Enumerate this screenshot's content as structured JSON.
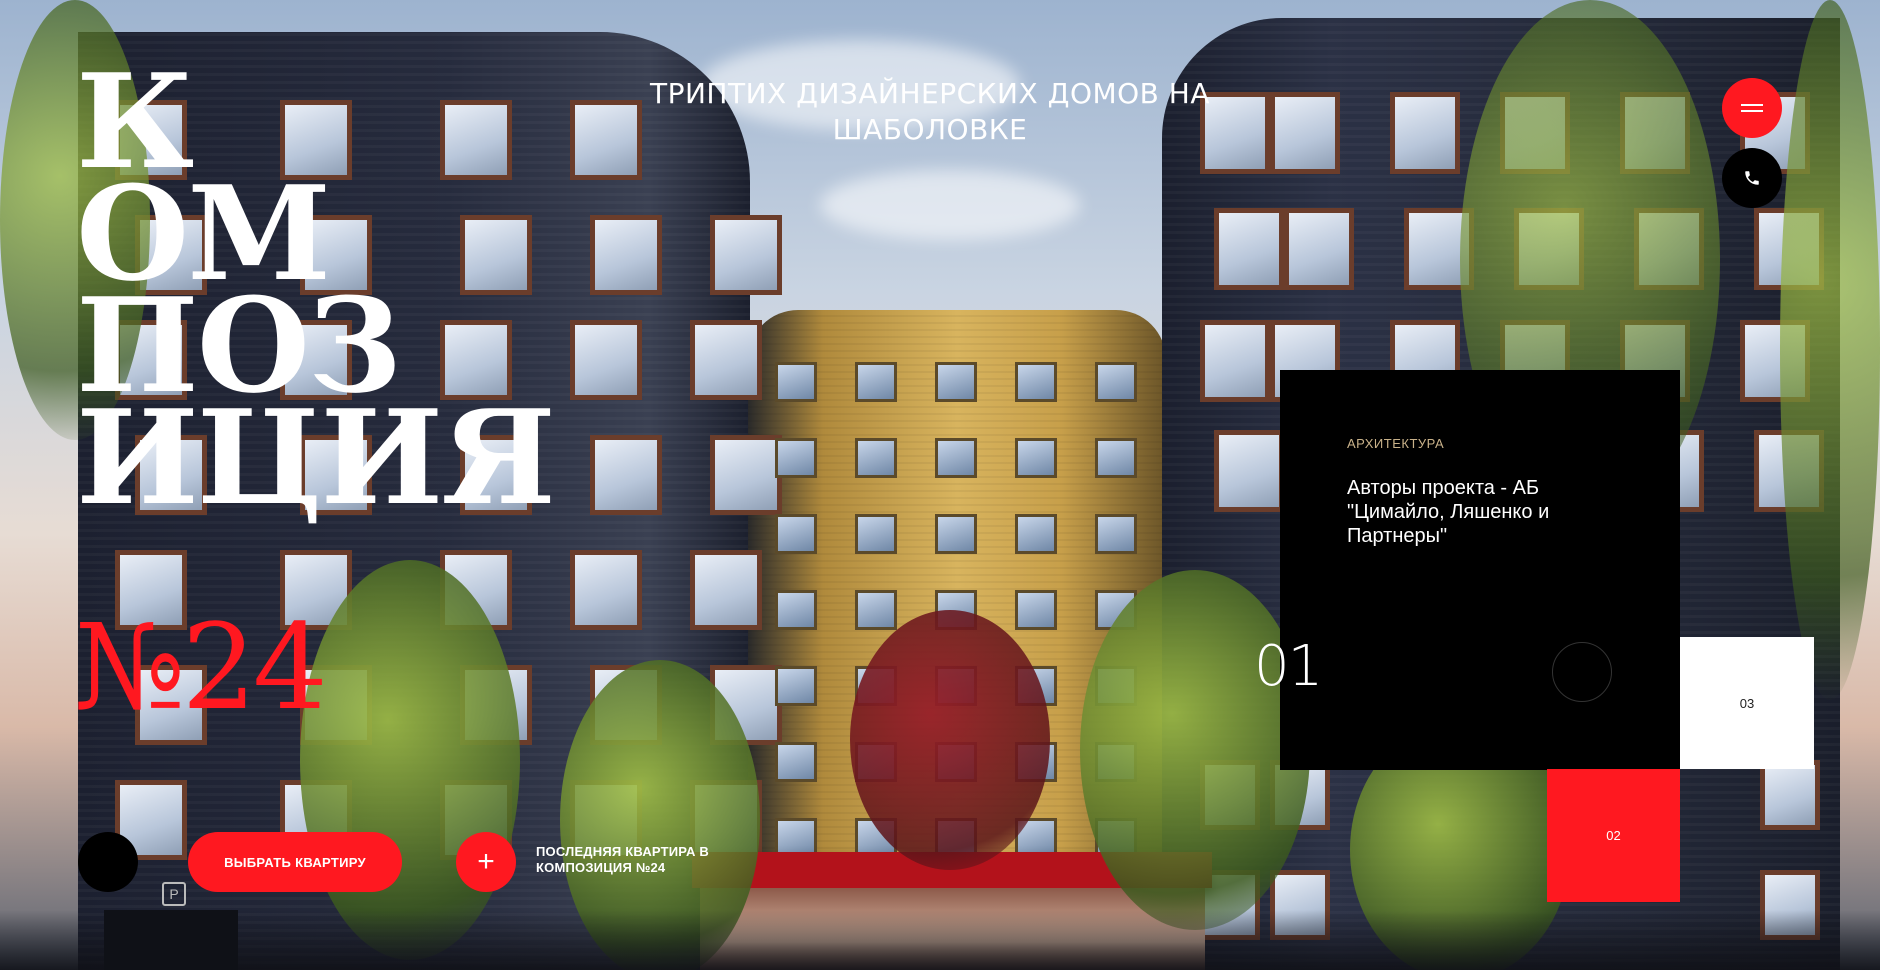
{
  "brand": {
    "title": "К\nОМ\nПОЗ\nИЦИЯ",
    "number": "№24"
  },
  "header": {
    "tagline": "ТРИПТИХ ДИЗАЙНЕРСКИХ ДОМОВ НА ШАБОЛОВКЕ",
    "menu_icon": "menu-icon",
    "phone_icon": "phone-icon"
  },
  "slider": {
    "current": "01",
    "card": {
      "label": "АРХИТЕКТУРА",
      "text": "Авторы проекта - АБ \"Цимайло, Ляшенко и Партнеры\""
    },
    "tiles": [
      "03",
      "02"
    ]
  },
  "actions": {
    "choose_apartment": "ВЫБРАТЬ КВАРТИРУ",
    "plus_icon": "plus-icon",
    "last_apartment": "ПОСЛЕДНЯЯ КВАРТИРА В КОМПОЗИЦИЯ №24"
  },
  "scene": {
    "parking_sign": "P"
  },
  "colors": {
    "accent": "#ff1820",
    "card": "#000000",
    "label": "#c9b28a"
  }
}
